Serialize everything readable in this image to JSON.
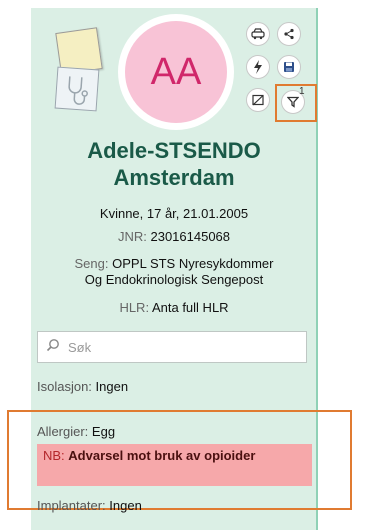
{
  "patient": {
    "initials": "AA",
    "first_name": "Adele-STSENDO",
    "last_name": "Amsterdam",
    "demographics": "Kvinne, 17 år, 21.01.2005",
    "jnr_label": "JNR:",
    "jnr_value": "23016145068",
    "bed_label": "Seng:",
    "bed_value_line1": "OPPL STS Nyresykdommer",
    "bed_value_line2": "Og Endokrinologisk Sengepost",
    "hlr_label": "HLR:",
    "hlr_value": "Anta full HLR"
  },
  "toolbar": {
    "icons": [
      "car-icon",
      "share-icon",
      "lightning-icon",
      "save-icon",
      "image-icon",
      "filter-icon"
    ],
    "filter_count": "1"
  },
  "search": {
    "placeholder": "Søk"
  },
  "details": {
    "isolation_label": "Isolasjon:",
    "isolation_value": "Ingen",
    "allergy_label": "Allergier:",
    "allergy_value": "Egg",
    "nb_label": "NB:",
    "nb_value": "Advarsel mot bruk av opioider",
    "implant_label": "Implantater:",
    "implant_value": "Ingen"
  },
  "colors": {
    "panel_bg": "#dbefe5",
    "name_color": "#1a5a48",
    "avatar_bg": "#f8c3d6",
    "avatar_text": "#d0276a",
    "highlight_outline": "#e07b31",
    "warning_bg": "#f6a8aa"
  }
}
